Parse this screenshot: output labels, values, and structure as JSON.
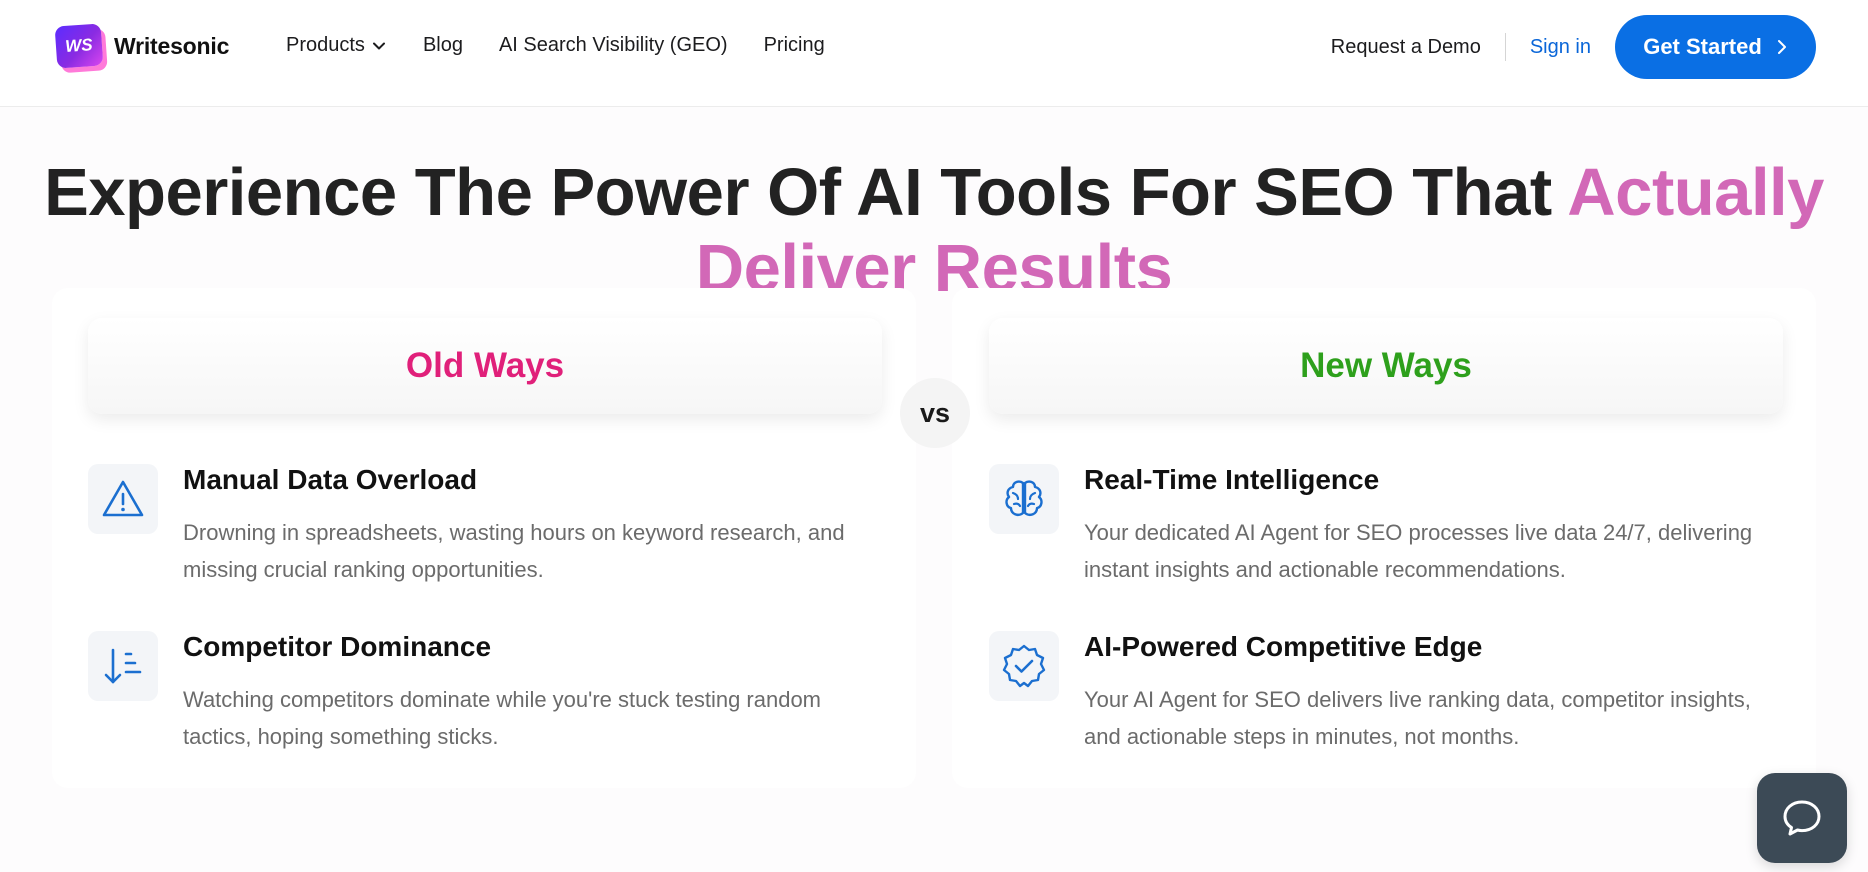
{
  "brand": {
    "logo_mark": "WS",
    "name": "Writesonic"
  },
  "nav": {
    "products": "Products",
    "blog": "Blog",
    "geo": "AI Search Visibility (GEO)",
    "pricing": "Pricing"
  },
  "header_actions": {
    "demo": "Request a Demo",
    "signin": "Sign in",
    "get_started": "Get Started"
  },
  "hero": {
    "title_main": "Experience The Power Of AI Tools For SEO That ",
    "title_accent": "Actually Deliver Results"
  },
  "comparison": {
    "old_label": "Old Ways",
    "vs_label": "vs",
    "new_label": "New Ways",
    "old_items": [
      {
        "icon": "warning-triangle-icon",
        "title": "Manual Data Overload",
        "description": "Drowning in spreadsheets, wasting hours on keyword research, and missing crucial ranking opportunities."
      },
      {
        "icon": "sort-descending-icon",
        "title": "Competitor Dominance",
        "description": "Watching competitors dominate while you're stuck testing random tactics, hoping something sticks."
      }
    ],
    "new_items": [
      {
        "icon": "brain-icon",
        "title": "Real-Time Intelligence",
        "description": "Your dedicated AI Agent for SEO processes live data 24/7, delivering instant insights and actionable recommendations."
      },
      {
        "icon": "verified-badge-icon",
        "title": "AI-Powered Competitive Edge",
        "description": "Your AI Agent for SEO delivers live ranking data, competitor insights, and actionable steps in minutes, not months."
      }
    ]
  },
  "colors": {
    "primary_blue": "#0a6fe4",
    "accent_pink": "#d268b7",
    "old_ways": "#e0207a",
    "new_ways": "#2ea01c",
    "icon_blue": "#1b6fd0",
    "chat_bg": "#3c4a56"
  },
  "chat_widget": {
    "icon": "chat-bubble-icon"
  }
}
